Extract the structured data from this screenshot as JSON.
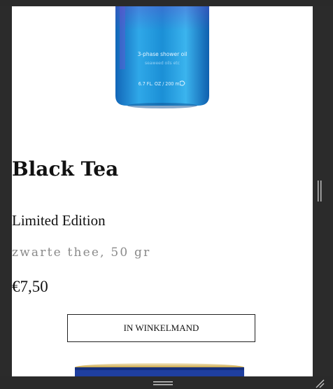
{
  "product": {
    "bottle_label_line1": "3-phase shower oil",
    "bottle_label_line2": "seaweed oils etc",
    "bottle_label_line3": "6.7 FL. OZ / 200 ml",
    "title": "Black Tea",
    "subtitle": "Limited Edition",
    "description": "zwarte thee, 50 gr",
    "price": "€7,50",
    "cart_button_label": "IN WINKELMAND"
  },
  "colors": {
    "page_bg": "#2b2b2b",
    "card_bg": "#ffffff",
    "bottle_blue": "#1f8fd8",
    "can_blue": "#1f3fa0",
    "muted_text": "#8a8a8a"
  },
  "icons": {
    "resize_handle": "resize-grip-icon",
    "drag_handle": "drag-handle-icon",
    "side_handle": "side-handle-icon"
  }
}
